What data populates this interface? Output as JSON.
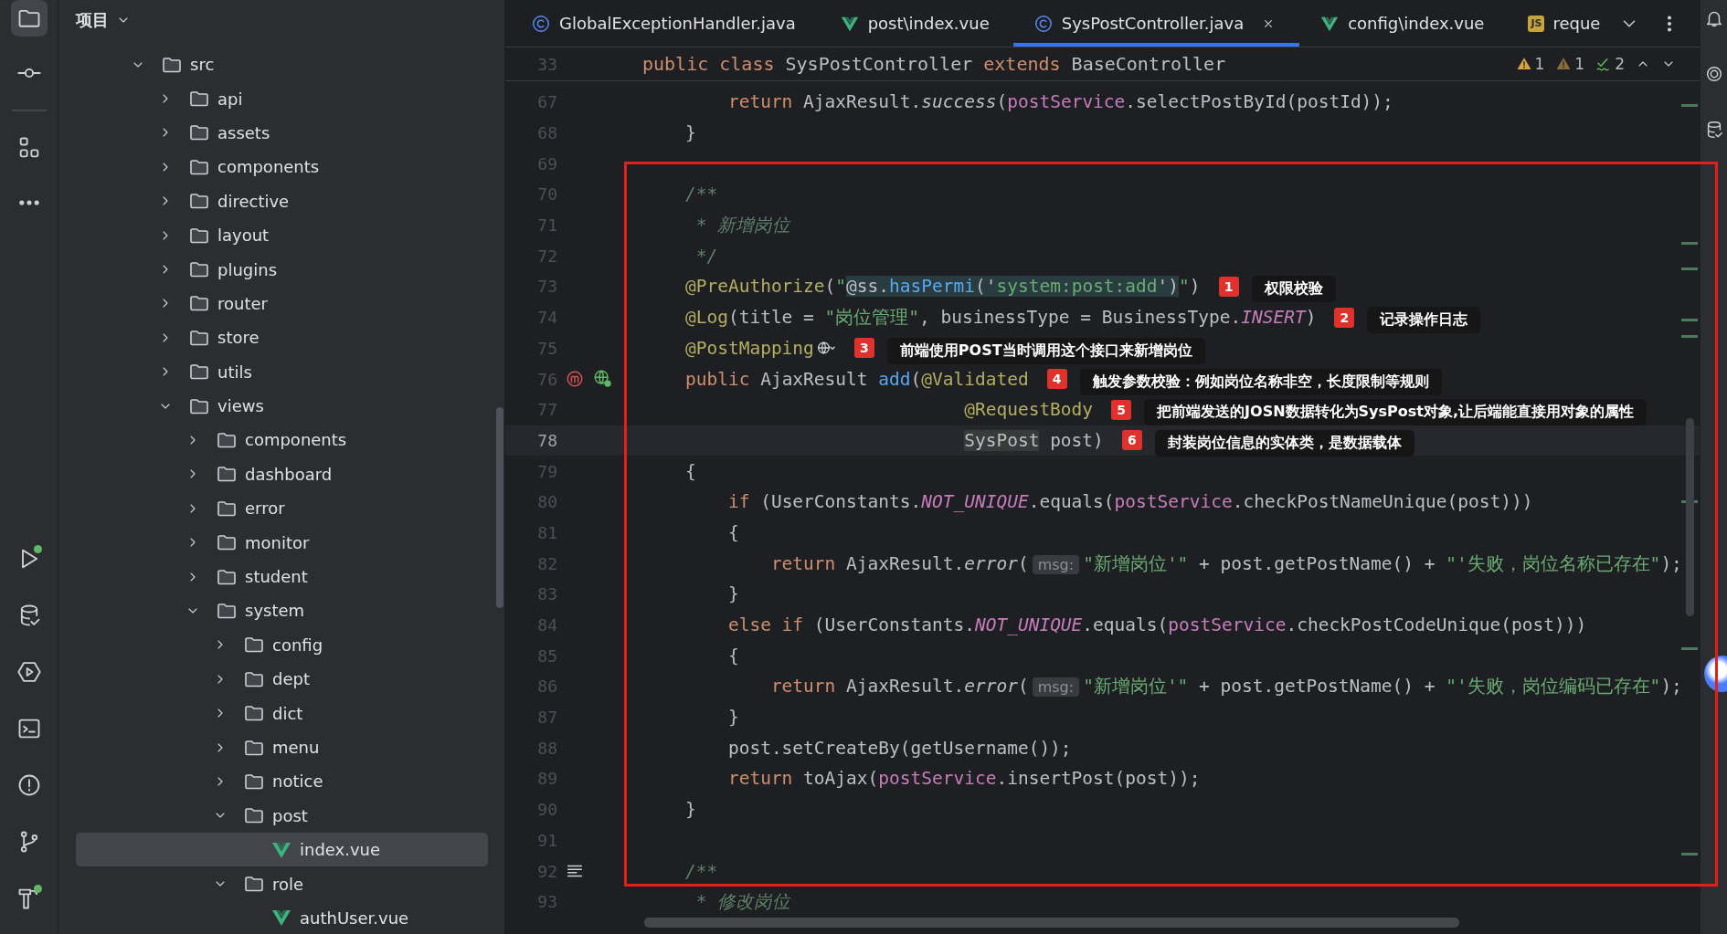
{
  "toolbar": {
    "top": [
      {
        "kind": "project",
        "selected": true,
        "notification": false
      },
      {
        "kind": "commit",
        "selected": false,
        "notification": false
      },
      {
        "kind": "structure",
        "selected": false,
        "notification": false
      },
      {
        "kind": "more",
        "selected": false,
        "notification": false
      }
    ],
    "bottom": [
      {
        "kind": "run",
        "selected": false,
        "notification": true
      },
      {
        "kind": "database",
        "selected": false,
        "notification": false
      },
      {
        "kind": "services",
        "selected": false,
        "notification": false
      },
      {
        "kind": "terminal",
        "selected": false,
        "notification": false
      },
      {
        "kind": "problems",
        "selected": false,
        "notification": false
      },
      {
        "kind": "git",
        "selected": false,
        "notification": false
      },
      {
        "kind": "build",
        "selected": false,
        "notification": true
      }
    ]
  },
  "project": {
    "title": "项目",
    "tree": [
      {
        "label": "src",
        "kind": "folder",
        "expanded": true,
        "selected": false,
        "children": [
          {
            "label": "api",
            "kind": "folder",
            "expanded": false,
            "selected": false
          },
          {
            "label": "assets",
            "kind": "folder",
            "expanded": false,
            "selected": false
          },
          {
            "label": "components",
            "kind": "folder",
            "expanded": false,
            "selected": false
          },
          {
            "label": "directive",
            "kind": "folder",
            "expanded": false,
            "selected": false
          },
          {
            "label": "layout",
            "kind": "folder",
            "expanded": false,
            "selected": false
          },
          {
            "label": "plugins",
            "kind": "folder",
            "expanded": false,
            "selected": false
          },
          {
            "label": "router",
            "kind": "folder",
            "expanded": false,
            "selected": false
          },
          {
            "label": "store",
            "kind": "folder",
            "expanded": false,
            "selected": false
          },
          {
            "label": "utils",
            "kind": "folder",
            "expanded": false,
            "selected": false
          },
          {
            "label": "views",
            "kind": "folder",
            "expanded": true,
            "selected": false,
            "children": [
              {
                "label": "components",
                "kind": "folder",
                "expanded": false,
                "selected": false
              },
              {
                "label": "dashboard",
                "kind": "folder",
                "expanded": false,
                "selected": false
              },
              {
                "label": "error",
                "kind": "folder",
                "expanded": false,
                "selected": false
              },
              {
                "label": "monitor",
                "kind": "folder",
                "expanded": false,
                "selected": false
              },
              {
                "label": "student",
                "kind": "folder",
                "expanded": false,
                "selected": false
              },
              {
                "label": "system",
                "kind": "folder",
                "expanded": true,
                "selected": false,
                "children": [
                  {
                    "label": "config",
                    "kind": "folder",
                    "expanded": false,
                    "selected": false
                  },
                  {
                    "label": "dept",
                    "kind": "folder",
                    "expanded": false,
                    "selected": false
                  },
                  {
                    "label": "dict",
                    "kind": "folder",
                    "expanded": false,
                    "selected": false
                  },
                  {
                    "label": "menu",
                    "kind": "folder",
                    "expanded": false,
                    "selected": false
                  },
                  {
                    "label": "notice",
                    "kind": "folder",
                    "expanded": false,
                    "selected": false
                  },
                  {
                    "label": "post",
                    "kind": "folder",
                    "expanded": true,
                    "selected": false,
                    "children": [
                      {
                        "label": "index.vue",
                        "kind": "vue",
                        "selected": true
                      }
                    ]
                  },
                  {
                    "label": "role",
                    "kind": "folder",
                    "expanded": true,
                    "selected": false,
                    "children": [
                      {
                        "label": "authUser.vue",
                        "kind": "vue",
                        "selected": false
                      }
                    ]
                  }
                ]
              }
            ]
          }
        ]
      }
    ]
  },
  "tabs": [
    {
      "label": "GlobalExceptionHandler.java",
      "kind": "java",
      "selected": false
    },
    {
      "label": "post\\index.vue",
      "kind": "vue",
      "selected": false
    },
    {
      "label": "SysPostController.java",
      "kind": "java",
      "selected": true
    },
    {
      "label": "config\\index.vue",
      "kind": "vue",
      "selected": false
    },
    {
      "label": "reque",
      "kind": "js",
      "icon_label": "JS",
      "selected": false
    }
  ],
  "editor": {
    "sticky": {
      "number": "33",
      "tokens": [
        {
          "text": "public",
          "kind": "keyword"
        },
        {
          "text": " class",
          "kind": "keyword"
        },
        {
          "text": " SysPostController ",
          "kind": "plain"
        },
        {
          "text": "extends",
          "kind": "keyword"
        },
        {
          "text": " BaseController",
          "kind": "plain"
        }
      ]
    },
    "inspections": [
      {
        "kind": "warning",
        "count": "1"
      },
      {
        "kind": "weak_warning",
        "count": "1"
      },
      {
        "kind": "typo",
        "count": "2"
      }
    ],
    "lines": [
      {
        "number": "67",
        "current": false,
        "tokens": [
          {
            "text": "        return",
            "kind": "keyword"
          },
          {
            "text": " AjaxResult.",
            "kind": "plain"
          },
          {
            "text": "success",
            "kind": "italic"
          },
          {
            "text": "(",
            "kind": "plain"
          },
          {
            "text": "postService",
            "kind": "field"
          },
          {
            "text": ".selectPostById(postId));",
            "kind": "plain"
          }
        ]
      },
      {
        "number": "68",
        "current": false,
        "tokens": [
          {
            "text": "    }",
            "kind": "plain"
          }
        ]
      },
      {
        "number": "69",
        "current": false
      },
      {
        "number": "70",
        "current": false,
        "tokens": [
          {
            "text": "    /**",
            "kind": "doc"
          }
        ]
      },
      {
        "number": "71",
        "current": false,
        "tokens": [
          {
            "text": "     * 新增岗位",
            "kind": "doc"
          }
        ]
      },
      {
        "number": "72",
        "current": false,
        "tokens": [
          {
            "text": "     */",
            "kind": "doc"
          }
        ]
      },
      {
        "number": "73",
        "current": false,
        "tokens": [
          {
            "text": "    @PreAuthorize",
            "kind": "annotation"
          },
          {
            "text": "(",
            "kind": "plain"
          },
          {
            "text": "\"",
            "kind": "string"
          },
          {
            "text": "@ss.",
            "kind": "spel"
          },
          {
            "text": "hasPermi",
            "kind": "spel_method"
          },
          {
            "text": "('",
            "kind": "spel"
          },
          {
            "text": "system:post:add",
            "kind": "spel_string"
          },
          {
            "text": "')",
            "kind": "spel"
          },
          {
            "text": "\"",
            "kind": "string"
          },
          {
            "text": ")",
            "kind": "plain"
          }
        ],
        "note": {
          "number": "1",
          "text": "权限校验"
        }
      },
      {
        "number": "74",
        "current": false,
        "tokens": [
          {
            "text": "    @Log",
            "kind": "annotation"
          },
          {
            "text": "(title = ",
            "kind": "plain"
          },
          {
            "text": "\"岗位管理\"",
            "kind": "string"
          },
          {
            "text": ", businessType = BusinessType.",
            "kind": "plain"
          },
          {
            "text": "INSERT",
            "kind": "constant"
          },
          {
            "text": ")",
            "kind": "plain"
          }
        ],
        "note": {
          "number": "2",
          "text": "记录操作日志"
        }
      },
      {
        "number": "75",
        "current": false,
        "tokens": [
          {
            "text": "    @PostMapping",
            "kind": "annotation"
          },
          {
            "kind": "endpoint_icon"
          }
        ],
        "note": {
          "number": "3",
          "text": "前端使用POST当时调用这个接口来新增岗位"
        }
      },
      {
        "number": "76",
        "current": false,
        "gutter_icons": [
          {
            "kind": "mapping"
          },
          {
            "kind": "endpoint"
          }
        ],
        "tokens": [
          {
            "text": "    public",
            "kind": "keyword"
          },
          {
            "text": " AjaxResult ",
            "kind": "plain"
          },
          {
            "text": "add",
            "kind": "method"
          },
          {
            "text": "(",
            "kind": "plain"
          },
          {
            "text": "@Validated",
            "kind": "annotation"
          }
        ],
        "note": {
          "number": "4",
          "text": "触发参数校验：例如岗位名称非空，长度限制等规则"
        }
      },
      {
        "number": "77",
        "current": false,
        "tokens": [
          {
            "text": "                              @RequestBody",
            "kind": "annotation"
          }
        ],
        "note": {
          "number": "5",
          "text": "把前端发送的JOSN数据转化为SysPost对象,让后端能直接用对象的属性"
        }
      },
      {
        "number": "78",
        "current": true,
        "tokens": [
          {
            "text": "                              SysPost",
            "kind": "usage"
          },
          {
            "text": " post)",
            "kind": "plain"
          }
        ],
        "note": {
          "number": "6",
          "text": "封装岗位信息的实体类，是数据载体"
        }
      },
      {
        "number": "79",
        "current": false,
        "tokens": [
          {
            "text": "    {",
            "kind": "plain"
          }
        ]
      },
      {
        "number": "80",
        "current": false,
        "tokens": [
          {
            "text": "        if",
            "kind": "keyword"
          },
          {
            "text": " (UserConstants.",
            "kind": "plain"
          },
          {
            "text": "NOT_UNIQUE",
            "kind": "constant"
          },
          {
            "text": ".equals(",
            "kind": "plain"
          },
          {
            "text": "postService",
            "kind": "field"
          },
          {
            "text": ".checkPostNameUnique(post)))",
            "kind": "plain"
          }
        ]
      },
      {
        "number": "81",
        "current": false,
        "tokens": [
          {
            "text": "        {",
            "kind": "plain"
          }
        ]
      },
      {
        "number": "82",
        "current": false,
        "tokens": [
          {
            "text": "            return",
            "kind": "keyword"
          },
          {
            "text": " AjaxResult.",
            "kind": "plain"
          },
          {
            "text": "error",
            "kind": "italic"
          },
          {
            "text": "(",
            "kind": "plain"
          },
          {
            "text": "msg:",
            "kind": "hint"
          },
          {
            "text": "\"新增岗位'\"",
            "kind": "string"
          },
          {
            "text": " + post.getPostName() + ",
            "kind": "plain"
          },
          {
            "text": "\"'失败，岗位名称已存在\"",
            "kind": "string"
          },
          {
            "text": ");",
            "kind": "plain"
          }
        ]
      },
      {
        "number": "83",
        "current": false,
        "tokens": [
          {
            "text": "        }",
            "kind": "plain"
          }
        ]
      },
      {
        "number": "84",
        "current": false,
        "tokens": [
          {
            "text": "        else if",
            "kind": "keyword"
          },
          {
            "text": " (UserConstants.",
            "kind": "plain"
          },
          {
            "text": "NOT_UNIQUE",
            "kind": "constant"
          },
          {
            "text": ".equals(",
            "kind": "plain"
          },
          {
            "text": "postService",
            "kind": "field"
          },
          {
            "text": ".checkPostCodeUnique(post)))",
            "kind": "plain"
          }
        ]
      },
      {
        "number": "85",
        "current": false,
        "tokens": [
          {
            "text": "        {",
            "kind": "plain"
          }
        ]
      },
      {
        "number": "86",
        "current": false,
        "tokens": [
          {
            "text": "            return",
            "kind": "keyword"
          },
          {
            "text": " AjaxResult.",
            "kind": "plain"
          },
          {
            "text": "error",
            "kind": "italic"
          },
          {
            "text": "(",
            "kind": "plain"
          },
          {
            "text": "msg:",
            "kind": "hint"
          },
          {
            "text": "\"新增岗位'\"",
            "kind": "string"
          },
          {
            "text": " + post.getPostName() + ",
            "kind": "plain"
          },
          {
            "text": "\"'失败，岗位编码已存在\"",
            "kind": "string"
          },
          {
            "text": ");",
            "kind": "plain"
          }
        ]
      },
      {
        "number": "87",
        "current": false,
        "tokens": [
          {
            "text": "        }",
            "kind": "plain"
          }
        ]
      },
      {
        "number": "88",
        "current": false,
        "tokens": [
          {
            "text": "        post.setCreateBy(getUsername());",
            "kind": "plain"
          }
        ]
      },
      {
        "number": "89",
        "current": false,
        "tokens": [
          {
            "text": "        return",
            "kind": "keyword"
          },
          {
            "text": " toAjax(",
            "kind": "plain"
          },
          {
            "text": "postService",
            "kind": "field"
          },
          {
            "text": ".insertPost(post));",
            "kind": "plain"
          }
        ]
      },
      {
        "number": "90",
        "current": false,
        "tokens": [
          {
            "text": "    }",
            "kind": "plain"
          }
        ]
      },
      {
        "number": "91",
        "current": false
      },
      {
        "number": "92",
        "current": false,
        "gutter_icons": [
          {
            "kind": "doc"
          }
        ],
        "tokens": [
          {
            "text": "    /**",
            "kind": "doc"
          }
        ]
      },
      {
        "number": "93",
        "current": false,
        "tokens": [
          {
            "text": "     * 修改岗位",
            "kind": "doc"
          }
        ]
      }
    ]
  },
  "right_toolbar": [
    {
      "kind": "notifications"
    },
    {
      "kind": "ai"
    },
    {
      "kind": "database"
    }
  ]
}
